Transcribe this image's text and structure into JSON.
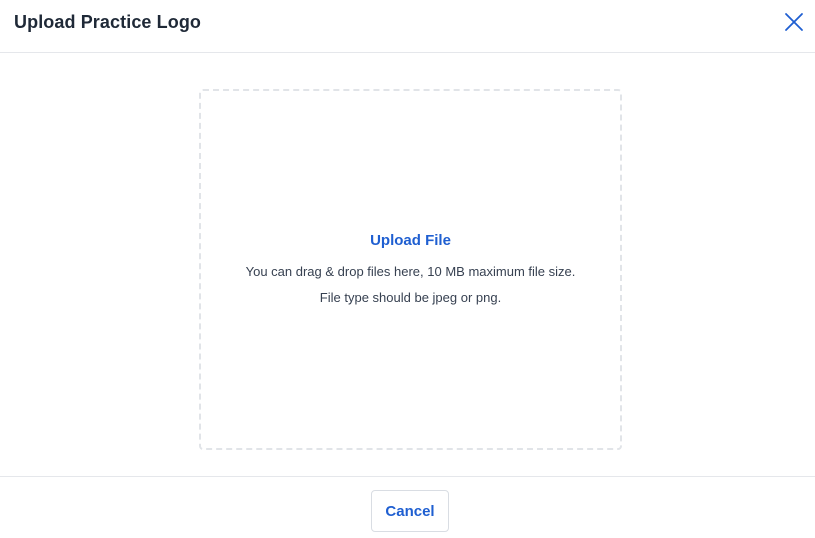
{
  "dialog": {
    "title": "Upload Practice Logo",
    "close_icon": "close-icon"
  },
  "dropzone": {
    "upload_label": "Upload File",
    "hint_line_1": "You can drag & drop files here, 10 MB maximum file size.",
    "hint_line_2": "File type should be jpeg or png."
  },
  "footer": {
    "cancel_label": "Cancel"
  },
  "colors": {
    "accent": "#1f5fd1",
    "text": "#1f2937",
    "border": "#e5e7eb",
    "dash": "#e1e4e8"
  }
}
